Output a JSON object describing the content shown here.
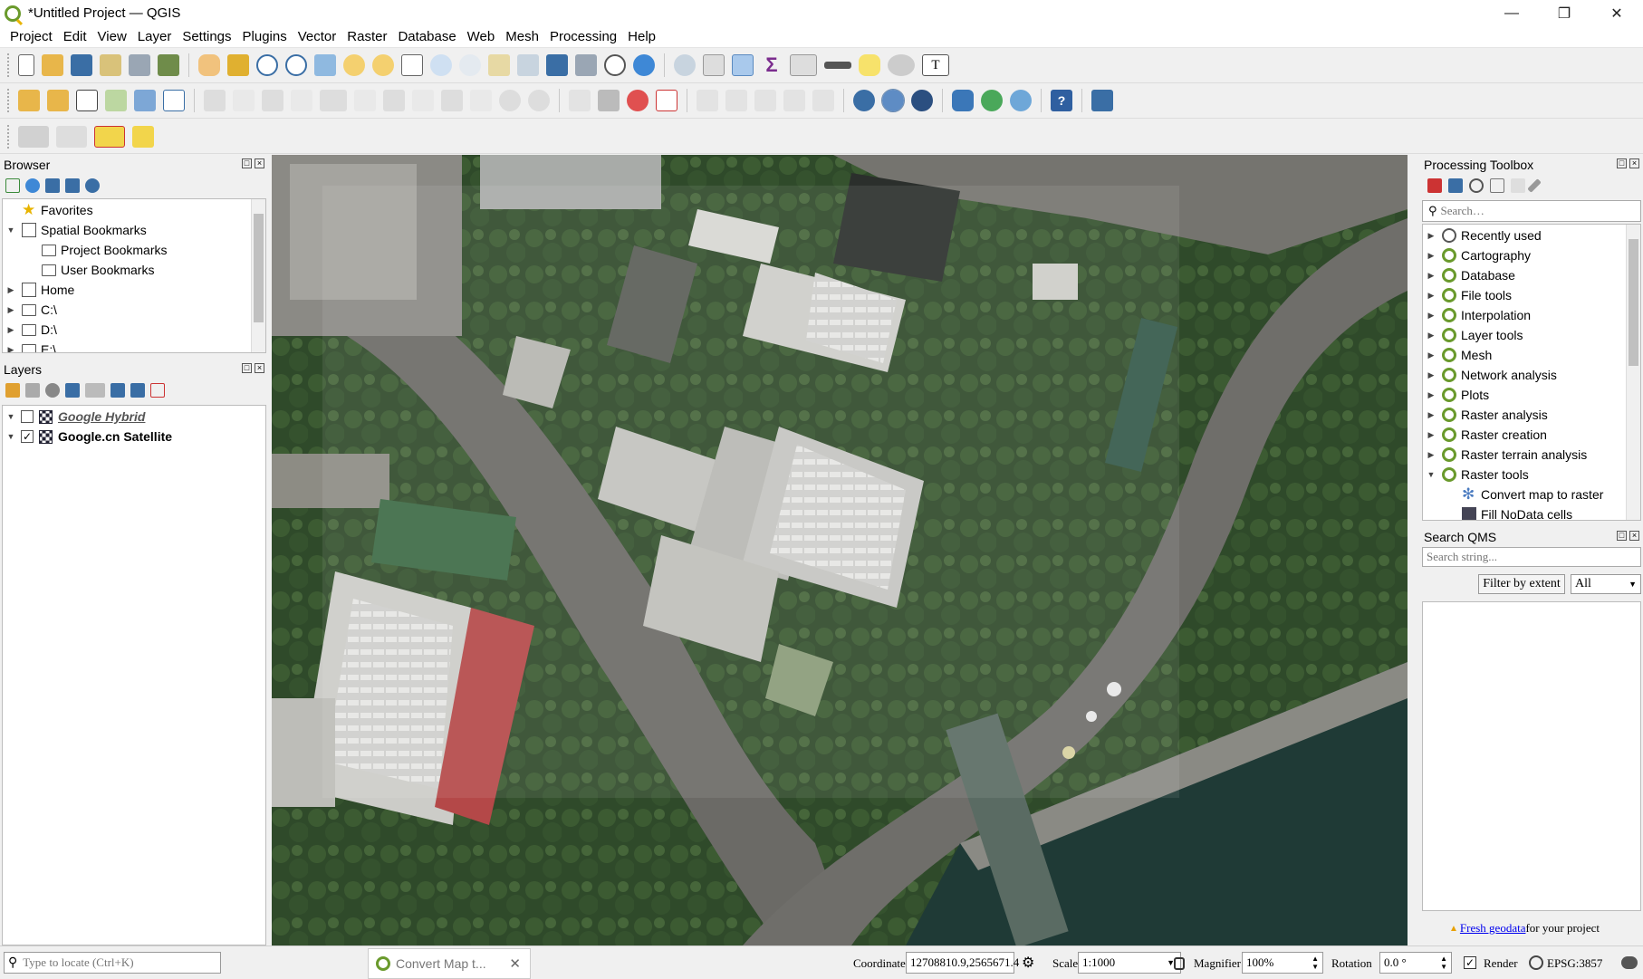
{
  "window": {
    "title": "*Untitled Project — QGIS",
    "controls": {
      "minimize": "—",
      "restore": "❐",
      "close": "✕"
    }
  },
  "menu": [
    "Project",
    "Edit",
    "View",
    "Layer",
    "Settings",
    "Plugins",
    "Vector",
    "Raster",
    "Database",
    "Web",
    "Mesh",
    "Processing",
    "Help"
  ],
  "browser": {
    "title": "Browser",
    "items": [
      {
        "label": "Favorites",
        "icon": "star-icon",
        "indent": 0,
        "arrow": ""
      },
      {
        "label": "Spatial Bookmarks",
        "icon": "bookmark-icon",
        "indent": 0,
        "arrow": "▼"
      },
      {
        "label": "Project Bookmarks",
        "icon": "folder-icon",
        "indent": 1,
        "arrow": ""
      },
      {
        "label": "User Bookmarks",
        "icon": "folder-icon",
        "indent": 1,
        "arrow": ""
      },
      {
        "label": "Home",
        "icon": "home-icon",
        "indent": 0,
        "arrow": "▶"
      },
      {
        "label": "C:\\",
        "icon": "folder-icon",
        "indent": 0,
        "arrow": "▶"
      },
      {
        "label": "D:\\",
        "icon": "folder-icon",
        "indent": 0,
        "arrow": "▶"
      },
      {
        "label": "E:\\",
        "icon": "folder-icon",
        "indent": 0,
        "arrow": "▶"
      }
    ]
  },
  "layers": {
    "title": "Layers",
    "items": [
      {
        "label": "Google Hybrid",
        "checked": false,
        "style": "italic"
      },
      {
        "label": "Google.cn Satellite",
        "checked": true,
        "style": "bold"
      }
    ]
  },
  "processing": {
    "title": "Processing Toolbox",
    "search_placeholder": "Search…",
    "items": [
      {
        "label": "Recently used",
        "icon": "clock-icon",
        "arrow": "▶",
        "indent": 0
      },
      {
        "label": "Cartography",
        "icon": "qgis-icon",
        "arrow": "▶",
        "indent": 0
      },
      {
        "label": "Database",
        "icon": "qgis-icon",
        "arrow": "▶",
        "indent": 0
      },
      {
        "label": "File tools",
        "icon": "qgis-icon",
        "arrow": "▶",
        "indent": 0
      },
      {
        "label": "Interpolation",
        "icon": "qgis-icon",
        "arrow": "▶",
        "indent": 0
      },
      {
        "label": "Layer tools",
        "icon": "qgis-icon",
        "arrow": "▶",
        "indent": 0
      },
      {
        "label": "Mesh",
        "icon": "qgis-icon",
        "arrow": "▶",
        "indent": 0
      },
      {
        "label": "Network analysis",
        "icon": "qgis-icon",
        "arrow": "▶",
        "indent": 0
      },
      {
        "label": "Plots",
        "icon": "qgis-icon",
        "arrow": "▶",
        "indent": 0
      },
      {
        "label": "Raster analysis",
        "icon": "qgis-icon",
        "arrow": "▶",
        "indent": 0
      },
      {
        "label": "Raster creation",
        "icon": "qgis-icon",
        "arrow": "▶",
        "indent": 0
      },
      {
        "label": "Raster terrain analysis",
        "icon": "qgis-icon",
        "arrow": "▶",
        "indent": 0
      },
      {
        "label": "Raster tools",
        "icon": "qgis-icon",
        "arrow": "▼",
        "indent": 0
      },
      {
        "label": "Convert map to raster",
        "icon": "gear-icon",
        "arrow": "",
        "indent": 1
      },
      {
        "label": "Fill NoData cells",
        "icon": "grid-icon",
        "arrow": "",
        "indent": 1
      }
    ]
  },
  "qms": {
    "title": "Search QMS",
    "search_placeholder": "Search string...",
    "filter_button": "Filter by extent",
    "filter_select": "All",
    "footer_link": "Fresh geodata",
    "footer_text": " for your project"
  },
  "status": {
    "locator_placeholder": "Type to locate (Ctrl+K)",
    "task_label": "Convert Map t...",
    "coordinate_label": "Coordinate",
    "coordinate_value": "12708810.9,2565671.4",
    "scale_label": "Scale",
    "scale_value": "1:1000",
    "magnifier_label": "Magnifier",
    "magnifier_value": "100%",
    "rotation_label": "Rotation",
    "rotation_value": "0.0 °",
    "render_label": "Render",
    "crs_label": "EPSG:3857"
  }
}
